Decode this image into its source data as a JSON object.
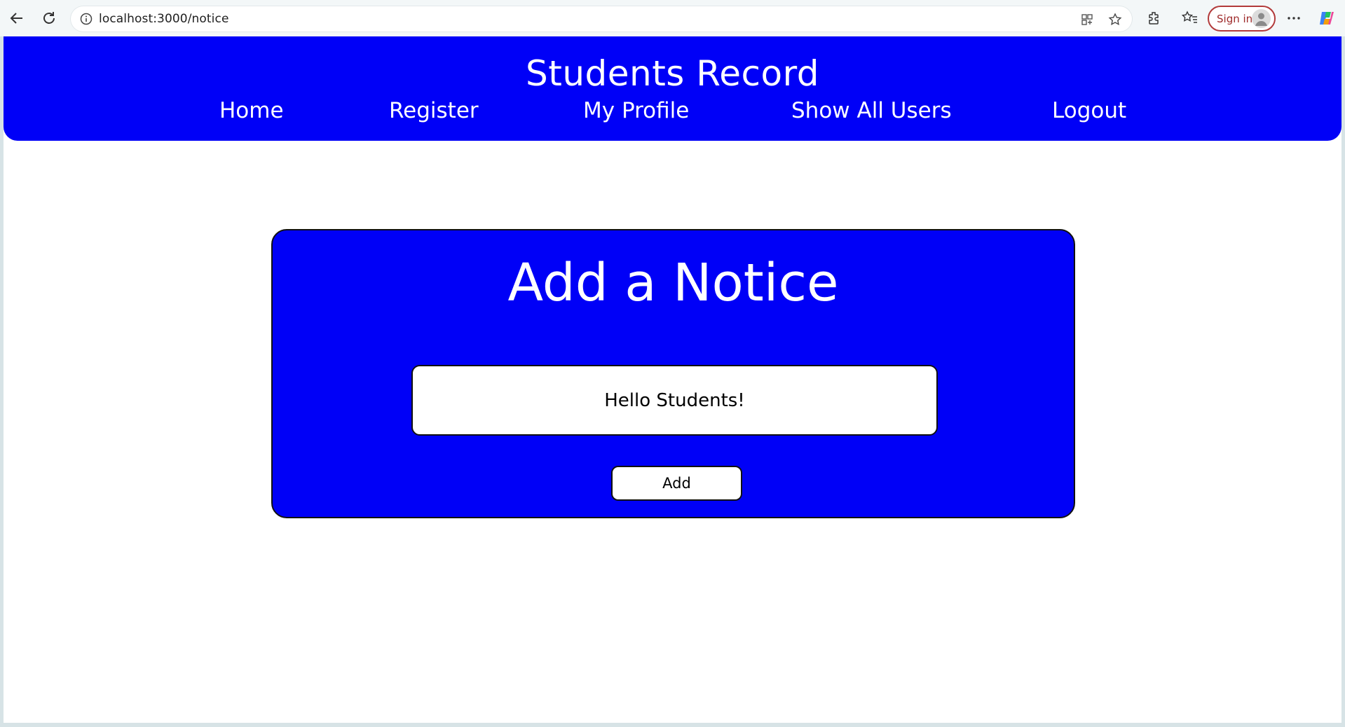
{
  "browser": {
    "url": "localhost:3000/notice",
    "sign_in_label": "Sign in",
    "icons": [
      "back-arrow-icon",
      "refresh-icon",
      "info-icon",
      "app-grid-icon",
      "star-icon",
      "extensions-icon",
      "favorites-icon",
      "avatar-icon",
      "more-icon",
      "copilot-icon"
    ]
  },
  "header": {
    "title": "Students Record",
    "nav": [
      {
        "label": "Home"
      },
      {
        "label": "Register"
      },
      {
        "label": "My Profile"
      },
      {
        "label": "Show All Users"
      },
      {
        "label": "Logout"
      }
    ]
  },
  "notice_form": {
    "title": "Add a Notice",
    "input_value": "Hello Students!",
    "add_label": "Add"
  },
  "colors": {
    "primary_blue": "#0000f7",
    "white": "#ffffff",
    "sign_in_red": "#b23a3a"
  }
}
